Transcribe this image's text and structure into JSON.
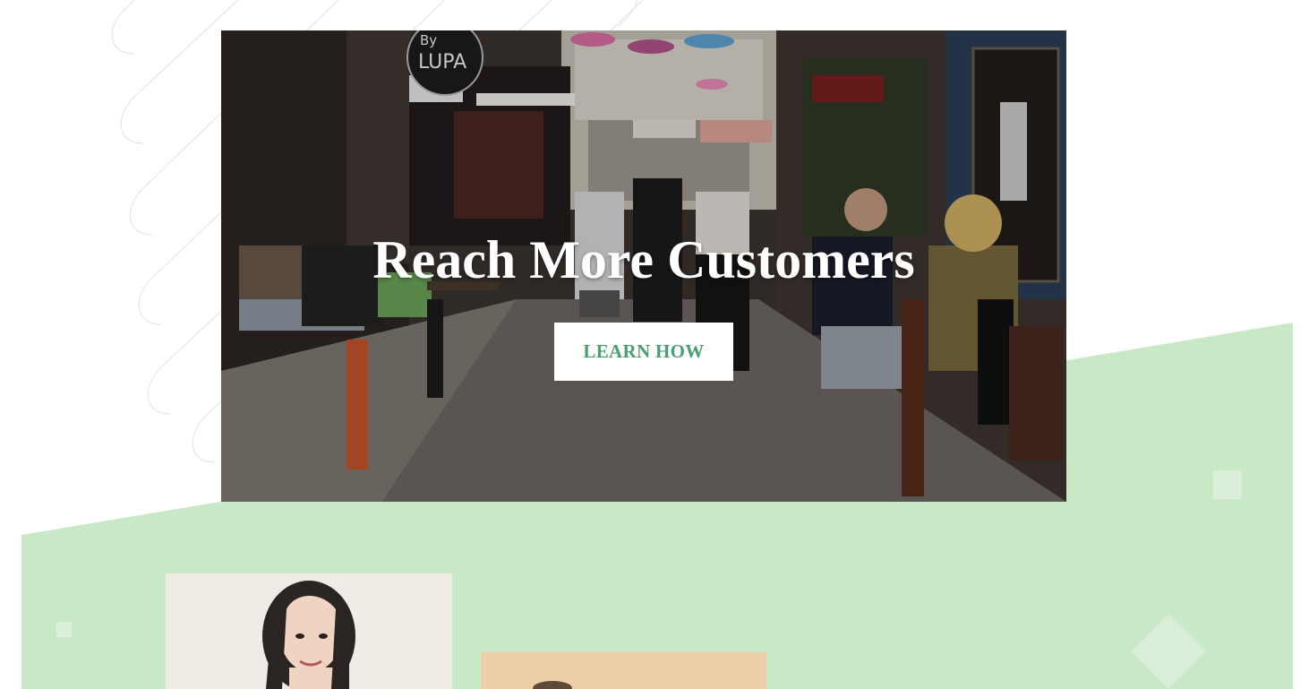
{
  "hero": {
    "title": "Reach More Customers",
    "cta_label": "LEARN HOW",
    "sign_text_1": "By",
    "sign_text_2": "LUPA"
  },
  "colors": {
    "accent_green": "#4a9e72",
    "band_green": "#c9e8c6",
    "button_bg": "#ffffff"
  },
  "team": {
    "photo_1": "woman-portrait",
    "photo_2": "person-portrait"
  }
}
